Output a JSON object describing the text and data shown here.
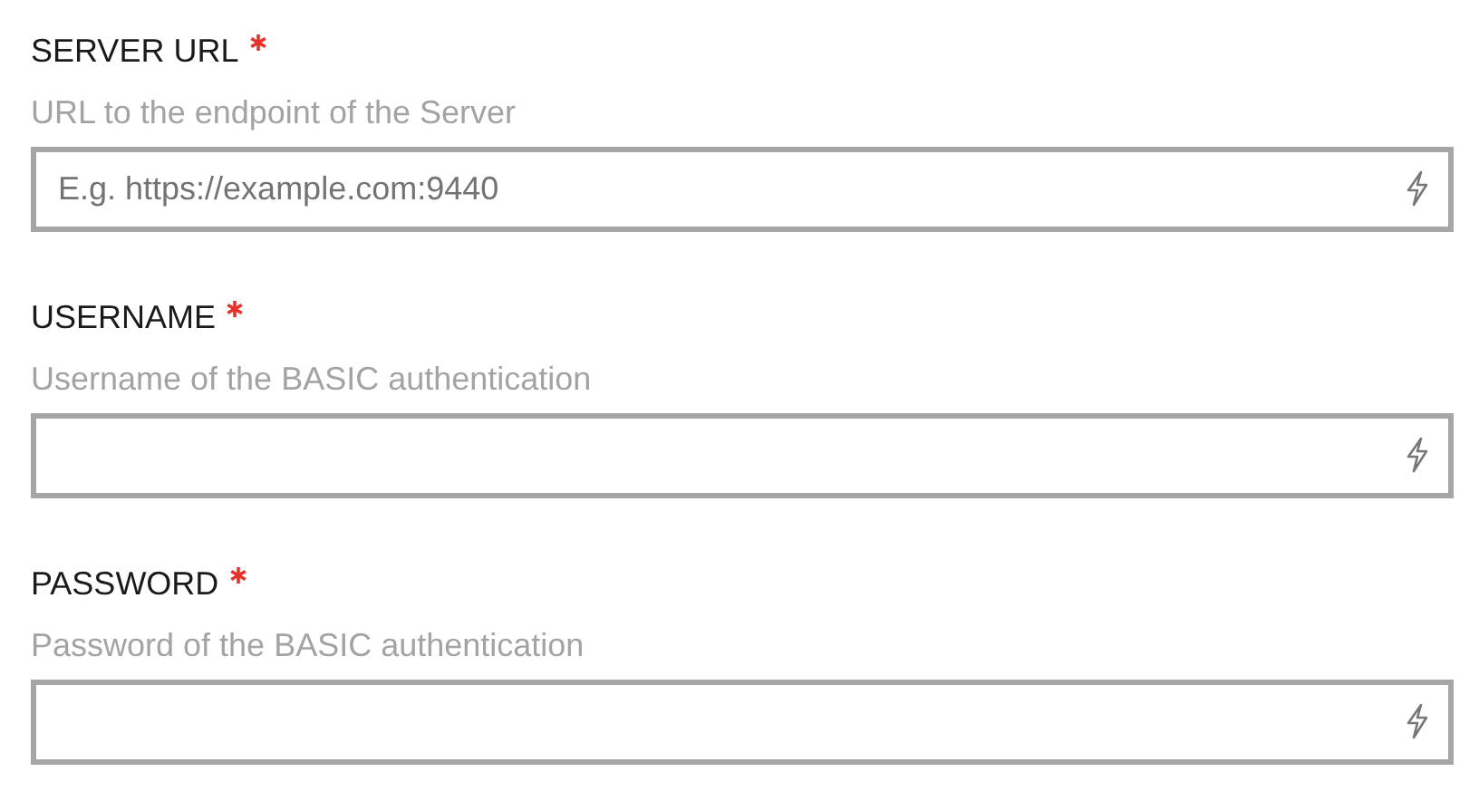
{
  "fields": [
    {
      "label": "SERVER URL",
      "required": true,
      "description": "URL to the endpoint of the Server",
      "placeholder": "E.g. https://example.com:9440"
    },
    {
      "label": "USERNAME",
      "required": true,
      "description": "Username of the BASIC authentication"
    },
    {
      "label": "PASSWORD",
      "required": true,
      "description": "Password of the BASIC authentication"
    }
  ]
}
